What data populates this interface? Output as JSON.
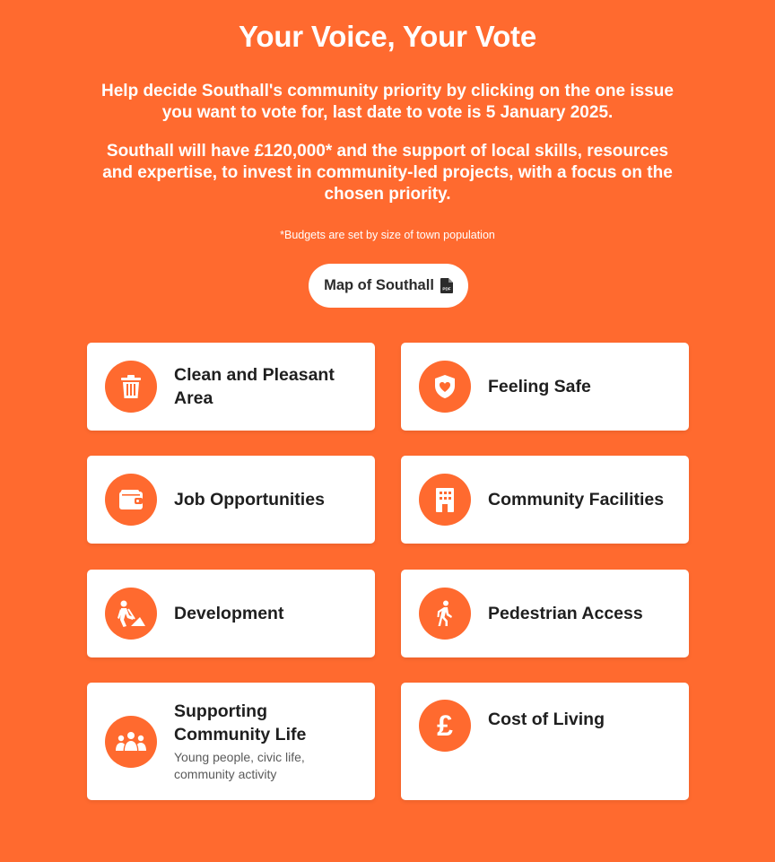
{
  "header": {
    "title": "Your Voice, Your Vote",
    "intro_1": "Help decide Southall's community priority by clicking on the one issue you want to vote for, last date to vote is 5 January 2025.",
    "intro_2": "Southall will have £120,000* and the support of local skills, resources and expertise, to invest in community-led projects, with a focus on the chosen priority.",
    "footnote": "*Budgets are set by size of town population",
    "map_button_label": "Map of Southall",
    "map_button_icon": "pdf-file-icon"
  },
  "colors": {
    "background": "#ff6a2f",
    "card": "#ffffff",
    "icon_circle": "#ff6a2f",
    "text_dark": "#1f1f1f",
    "text_muted": "#5a5a5a"
  },
  "options": [
    {
      "title": "Clean and Pleasant Area",
      "icon": "trash-bin-icon"
    },
    {
      "title": "Feeling Safe",
      "icon": "heart-shield-icon"
    },
    {
      "title": "Job Opportunities",
      "icon": "wallet-icon"
    },
    {
      "title": "Community Facilities",
      "icon": "building-icon"
    },
    {
      "title": "Development",
      "icon": "construction-worker-icon"
    },
    {
      "title": "Pedestrian Access",
      "icon": "walking-person-icon"
    },
    {
      "title": "Supporting Community Life",
      "description": "Young people, civic life, community activity",
      "icon": "people-group-icon"
    },
    {
      "title": "Cost of Living",
      "icon": "pound-sign-icon"
    }
  ]
}
